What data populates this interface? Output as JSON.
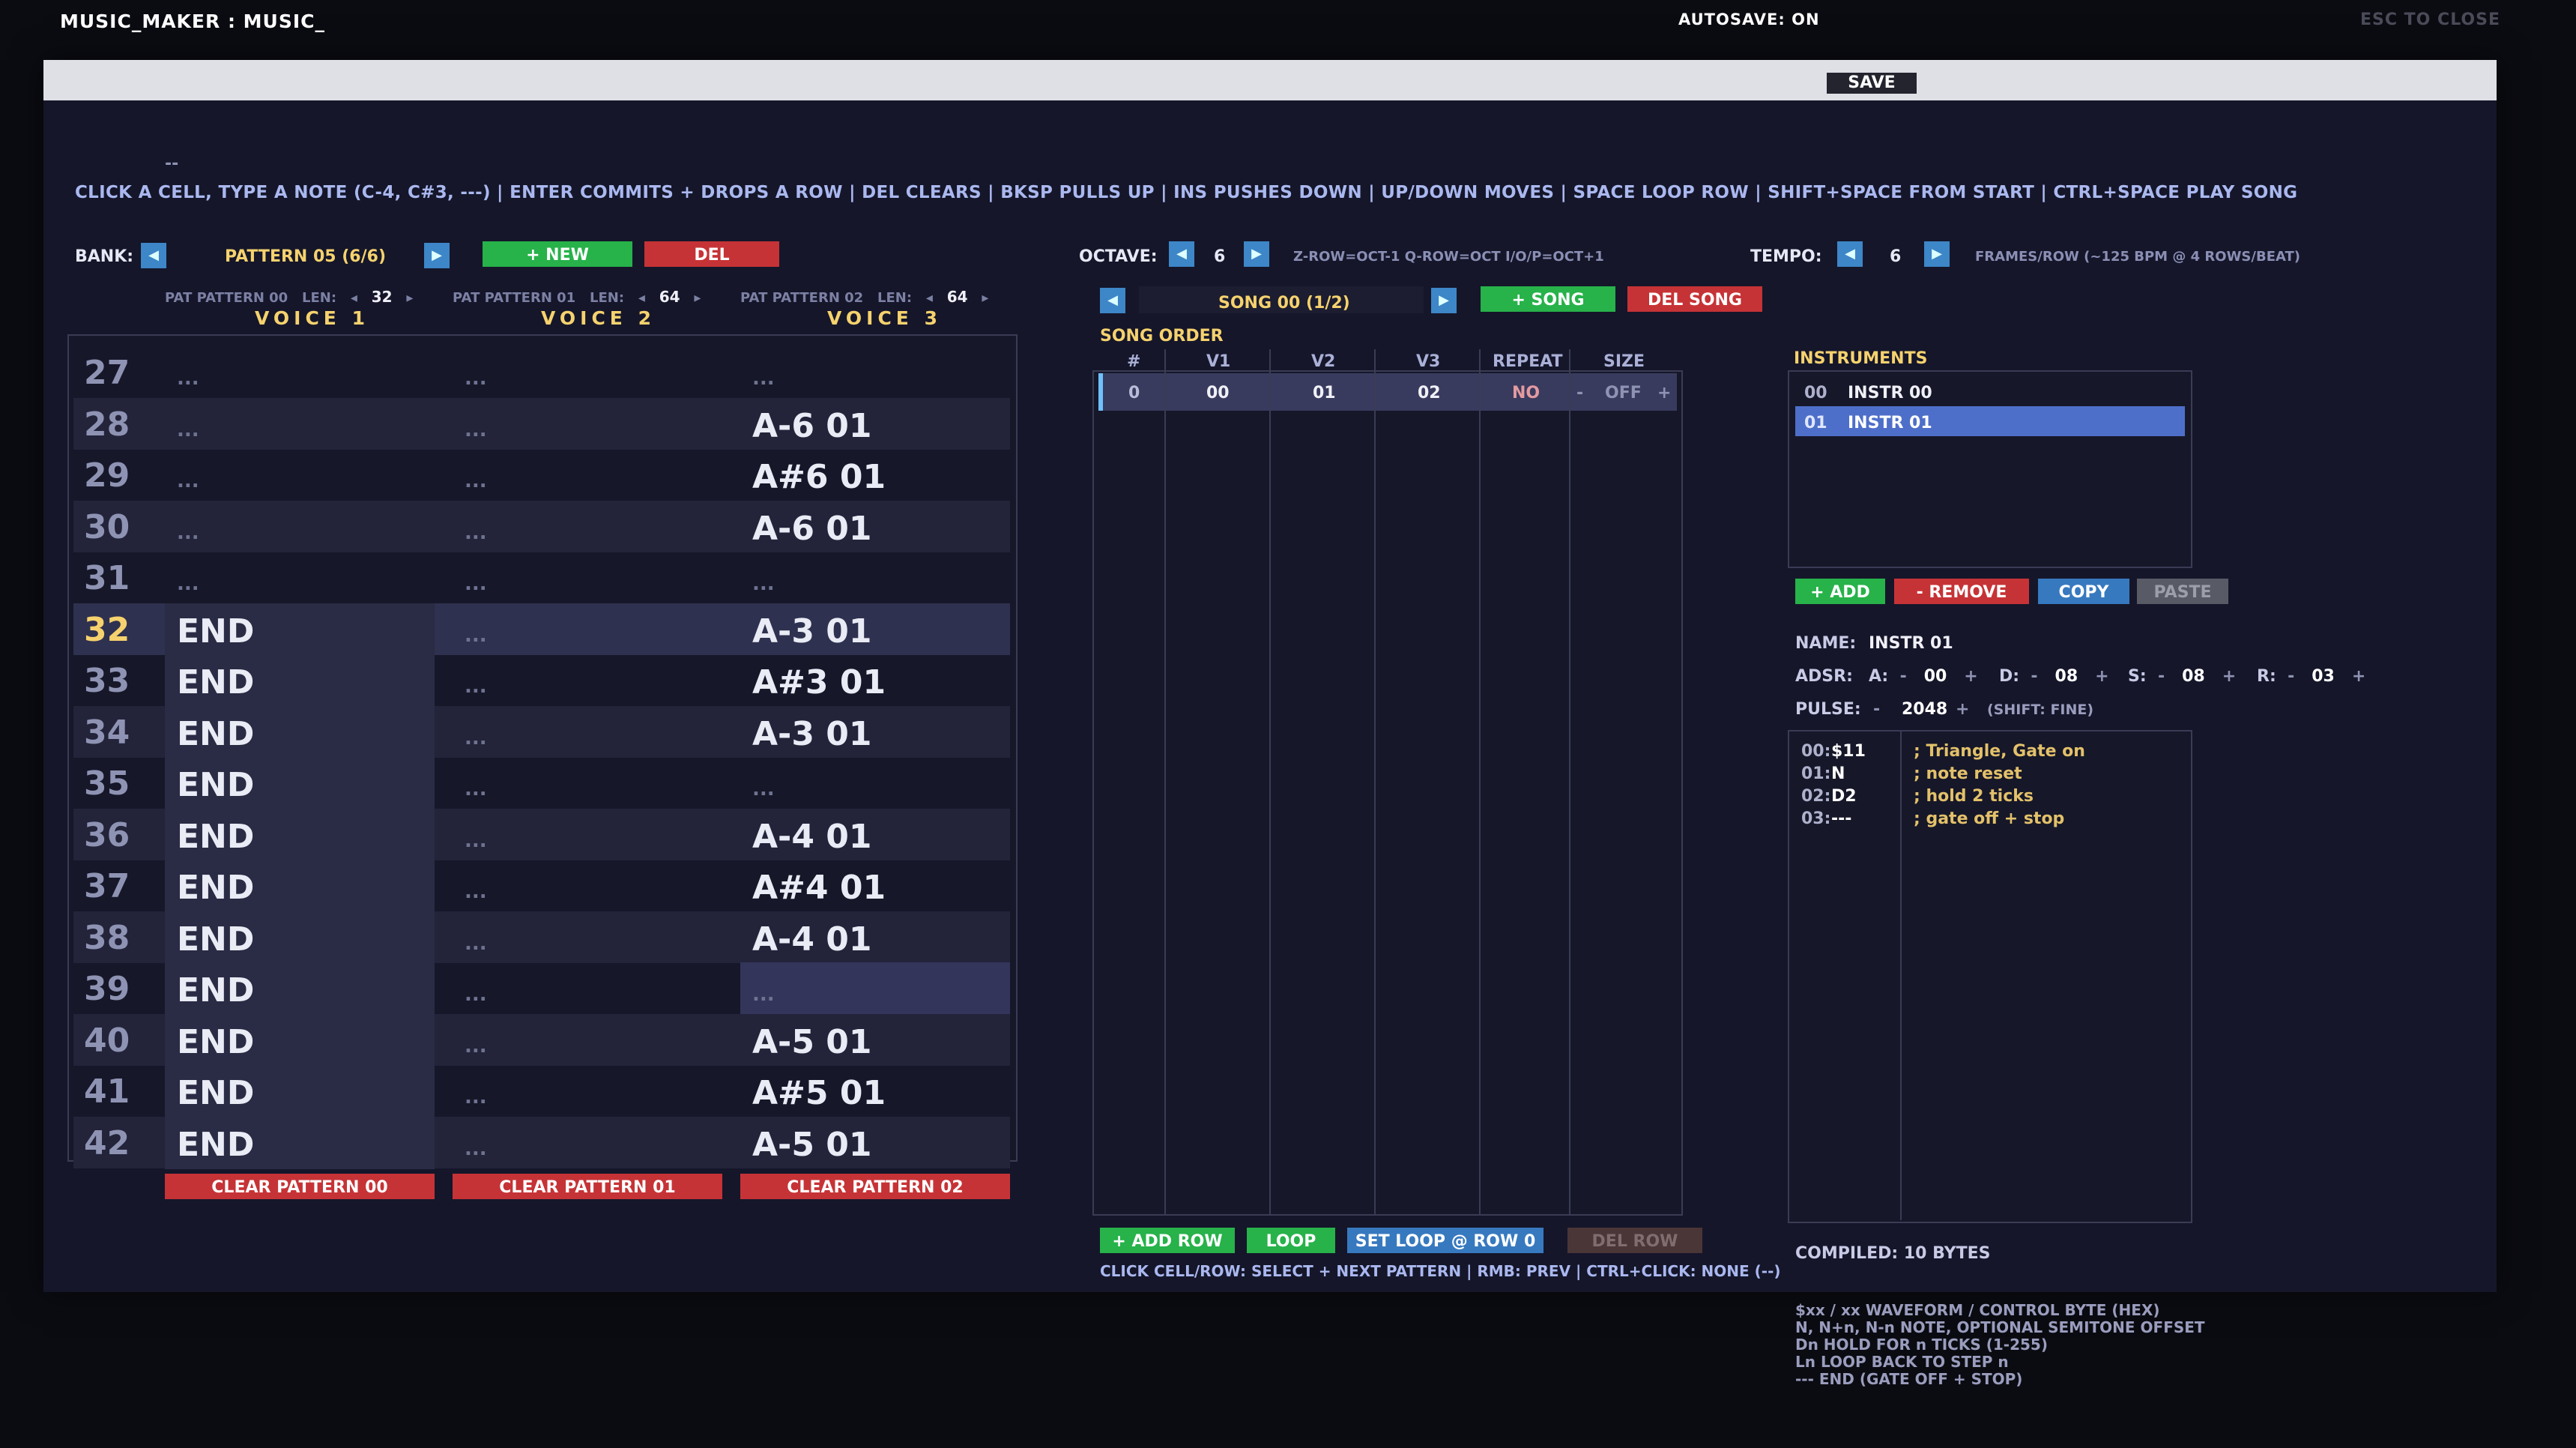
{
  "title": "MUSIC_MAKER : MUSIC_",
  "autosave": "AUTOSAVE: ON",
  "save_label": "SAVE",
  "esc_label": "ESC TO CLOSE",
  "dashes": "--",
  "help_text": "CLICK A CELL, TYPE A NOTE (C-4, C#3, ---)  |  ENTER COMMITS + DROPS A ROW  |  DEL CLEARS  |  BKSP PULLS UP  |  INS PUSHES DOWN  |  UP/DOWN MOVES  |  SPACE LOOP ROW  |  SHIFT+SPACE FROM START  |  CTRL+SPACE PLAY SONG",
  "bank": {
    "label": "BANK:",
    "pattern": "PATTERN 05  (6/6)",
    "new_label": "+ NEW",
    "del_label": "DEL"
  },
  "octave": {
    "label": "OCTAVE:",
    "value": "6",
    "hint": "Z-ROW=OCT-1  Q-ROW=OCT  I/O/P=OCT+1"
  },
  "tempo": {
    "label": "TEMPO:",
    "value": "6",
    "hint": "FRAMES/ROW  (~125 BPM @ 4 ROWS/BEAT)"
  },
  "patterns": [
    {
      "name": "PAT PATTERN 00",
      "len_label": "LEN:",
      "len": "32",
      "voice": "VOICE 1",
      "clear": "CLEAR PATTERN 00"
    },
    {
      "name": "PAT PATTERN 01",
      "len_label": "LEN:",
      "len": "64",
      "voice": "VOICE 2",
      "clear": "CLEAR PATTERN 01"
    },
    {
      "name": "PAT PATTERN 02",
      "len_label": "LEN:",
      "len": "64",
      "voice": "VOICE 3",
      "clear": "CLEAR PATTERN 02"
    }
  ],
  "dots": "...",
  "rows": [
    {
      "n": "27",
      "v1": "...",
      "v2": "...",
      "v3": "..."
    },
    {
      "n": "28",
      "v1": "...",
      "v2": "...",
      "v3": "A-6 01"
    },
    {
      "n": "29",
      "v1": "...",
      "v2": "...",
      "v3": "A#6 01"
    },
    {
      "n": "30",
      "v1": "...",
      "v2": "...",
      "v3": "A-6 01"
    },
    {
      "n": "31",
      "v1": "...",
      "v2": "...",
      "v3": "..."
    },
    {
      "n": "32",
      "v1": "END",
      "v2": "...",
      "v3": "A-3 01"
    },
    {
      "n": "33",
      "v1": "END",
      "v2": "...",
      "v3": "A#3 01"
    },
    {
      "n": "34",
      "v1": "END",
      "v2": "...",
      "v3": "A-3 01"
    },
    {
      "n": "35",
      "v1": "END",
      "v2": "...",
      "v3": "..."
    },
    {
      "n": "36",
      "v1": "END",
      "v2": "...",
      "v3": "A-4 01"
    },
    {
      "n": "37",
      "v1": "END",
      "v2": "...",
      "v3": "A#4 01"
    },
    {
      "n": "38",
      "v1": "END",
      "v2": "...",
      "v3": "A-4 01"
    },
    {
      "n": "39",
      "v1": "END",
      "v2": "...",
      "v3": "..."
    },
    {
      "n": "40",
      "v1": "END",
      "v2": "...",
      "v3": "A-5 01"
    },
    {
      "n": "41",
      "v1": "END",
      "v2": "...",
      "v3": "A#5 01"
    },
    {
      "n": "42",
      "v1": "END",
      "v2": "...",
      "v3": "A-5 01"
    }
  ],
  "song": {
    "name": "SONG 00  (1/2)",
    "add_label": "+ SONG",
    "del_label": "DEL SONG",
    "order_title": "SONG ORDER",
    "headers": [
      "#",
      "V1",
      "V2",
      "V3",
      "REPEAT",
      "SIZE"
    ],
    "row": {
      "num": "0",
      "v1": "00",
      "v2": "01",
      "v3": "02",
      "repeat": "NO",
      "minus": "-",
      "size": "OFF",
      "plus": "+"
    },
    "add_row": "+ ADD ROW",
    "loop": "LOOP",
    "set_loop": "SET LOOP @ ROW 0",
    "del_row": "DEL ROW",
    "hint": "CLICK CELL/ROW: SELECT + NEXT PATTERN   |   RMB: PREV   |   CTRL+CLICK: NONE (--)"
  },
  "instruments": {
    "title": "INSTRUMENTS",
    "items": [
      {
        "id": "00",
        "name": "INSTR 00"
      },
      {
        "id": "01",
        "name": "INSTR 01"
      }
    ],
    "add": "+ ADD",
    "remove": "- REMOVE",
    "copy": "COPY",
    "paste": "PASTE",
    "name_label": "NAME:",
    "name_value": "INSTR 01",
    "adsr_label": "ADSR:",
    "a_label": "A:",
    "a": "00",
    "d_label": "D:",
    "d": "08",
    "s_label": "S:",
    "s": "08",
    "r_label": "R:",
    "r": "03",
    "minus": "-",
    "plus": "+",
    "pulse_label": "PULSE:",
    "pulse": "2048",
    "pulse_hint": "(SHIFT: FINE)",
    "program": [
      {
        "step": "00:",
        "cmd": "$11",
        "comment": "; Triangle, Gate on"
      },
      {
        "step": "01:",
        "cmd": "N",
        "comment": "; note reset"
      },
      {
        "step": "02:",
        "cmd": "D2",
        "comment": "; hold 2 ticks"
      },
      {
        "step": "03:",
        "cmd": "---",
        "comment": "; gate off + stop"
      }
    ],
    "compiled": "COMPILED: 10 BYTES",
    "legend": [
      "$xx / xx   WAVEFORM / CONTROL BYTE (HEX)",
      "N, N+n, N-n   NOTE, OPTIONAL SEMITONE OFFSET",
      "Dn   HOLD FOR n TICKS (1-255)",
      "Ln   LOOP BACK TO STEP n",
      "---   END (GATE OFF + STOP)"
    ]
  },
  "colors": {
    "accent": "#f6d26e",
    "green": "#27b24a",
    "red": "#c63336",
    "blue": "#3779bf",
    "select": "#4e6fc9"
  }
}
